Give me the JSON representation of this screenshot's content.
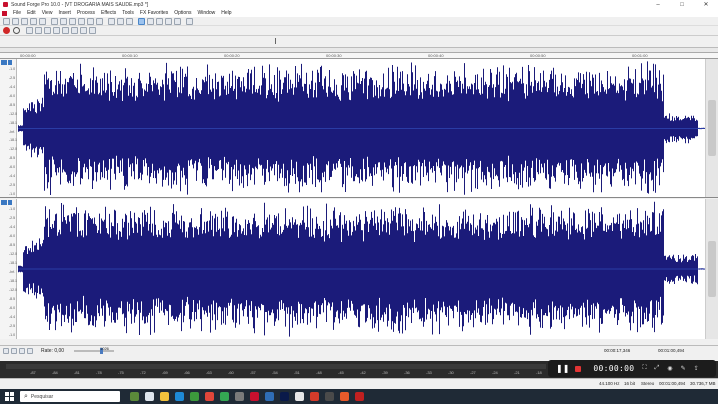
{
  "window": {
    "title": "Sound Forge Pro 10.0 - [VT DROGARIA MAIS SAUDE.mp3 *]",
    "buttons": {
      "minimize": "–",
      "maximize": "□",
      "close": "✕"
    }
  },
  "menu": [
    "File",
    "Edit",
    "View",
    "Insert",
    "Process",
    "Effects",
    "Tools",
    "FX Favorites",
    "Options",
    "Window",
    "Help"
  ],
  "ruler_labels": [
    "00:00:00",
    "00:00:10",
    "00:00:20",
    "00:00:30",
    "00:00:40",
    "00:00:50",
    "00:01:00"
  ],
  "channels": {
    "db_labels": [
      "-1.0",
      "-2.5",
      "-4.4",
      "-6.0",
      "-8.5",
      "-12.0",
      "-18.1",
      "-Inf.",
      "-18.1",
      "-12.0",
      "-8.5",
      "-6.0",
      "-4.4",
      "-2.5",
      "-1.0"
    ],
    "waveform_color": "#1b1b7a"
  },
  "transport": {
    "rate_label": "Rate: 0,00",
    "slider_value": "1026",
    "position": "00:00:17,346",
    "total": "00:01:00,494"
  },
  "meter": {
    "labels": [
      "-87",
      "-84",
      "-81",
      "-78",
      "-75",
      "-72",
      "-69",
      "-66",
      "-63",
      "-60",
      "-57",
      "-54",
      "-51",
      "-48",
      "-45",
      "-42",
      "-39",
      "-36",
      "-33",
      "-30",
      "-27",
      "-24",
      "-21",
      "-18",
      "-15"
    ]
  },
  "recorder": {
    "time": "00:00:00"
  },
  "status": {
    "sample_rate": "44.100 Hz",
    "bit_depth": "16 bit",
    "channels": "Stereo",
    "length": "00:01:00,494",
    "free": "30.736,7 MB"
  },
  "taskbar": {
    "search_placeholder": "Pesquisar"
  }
}
